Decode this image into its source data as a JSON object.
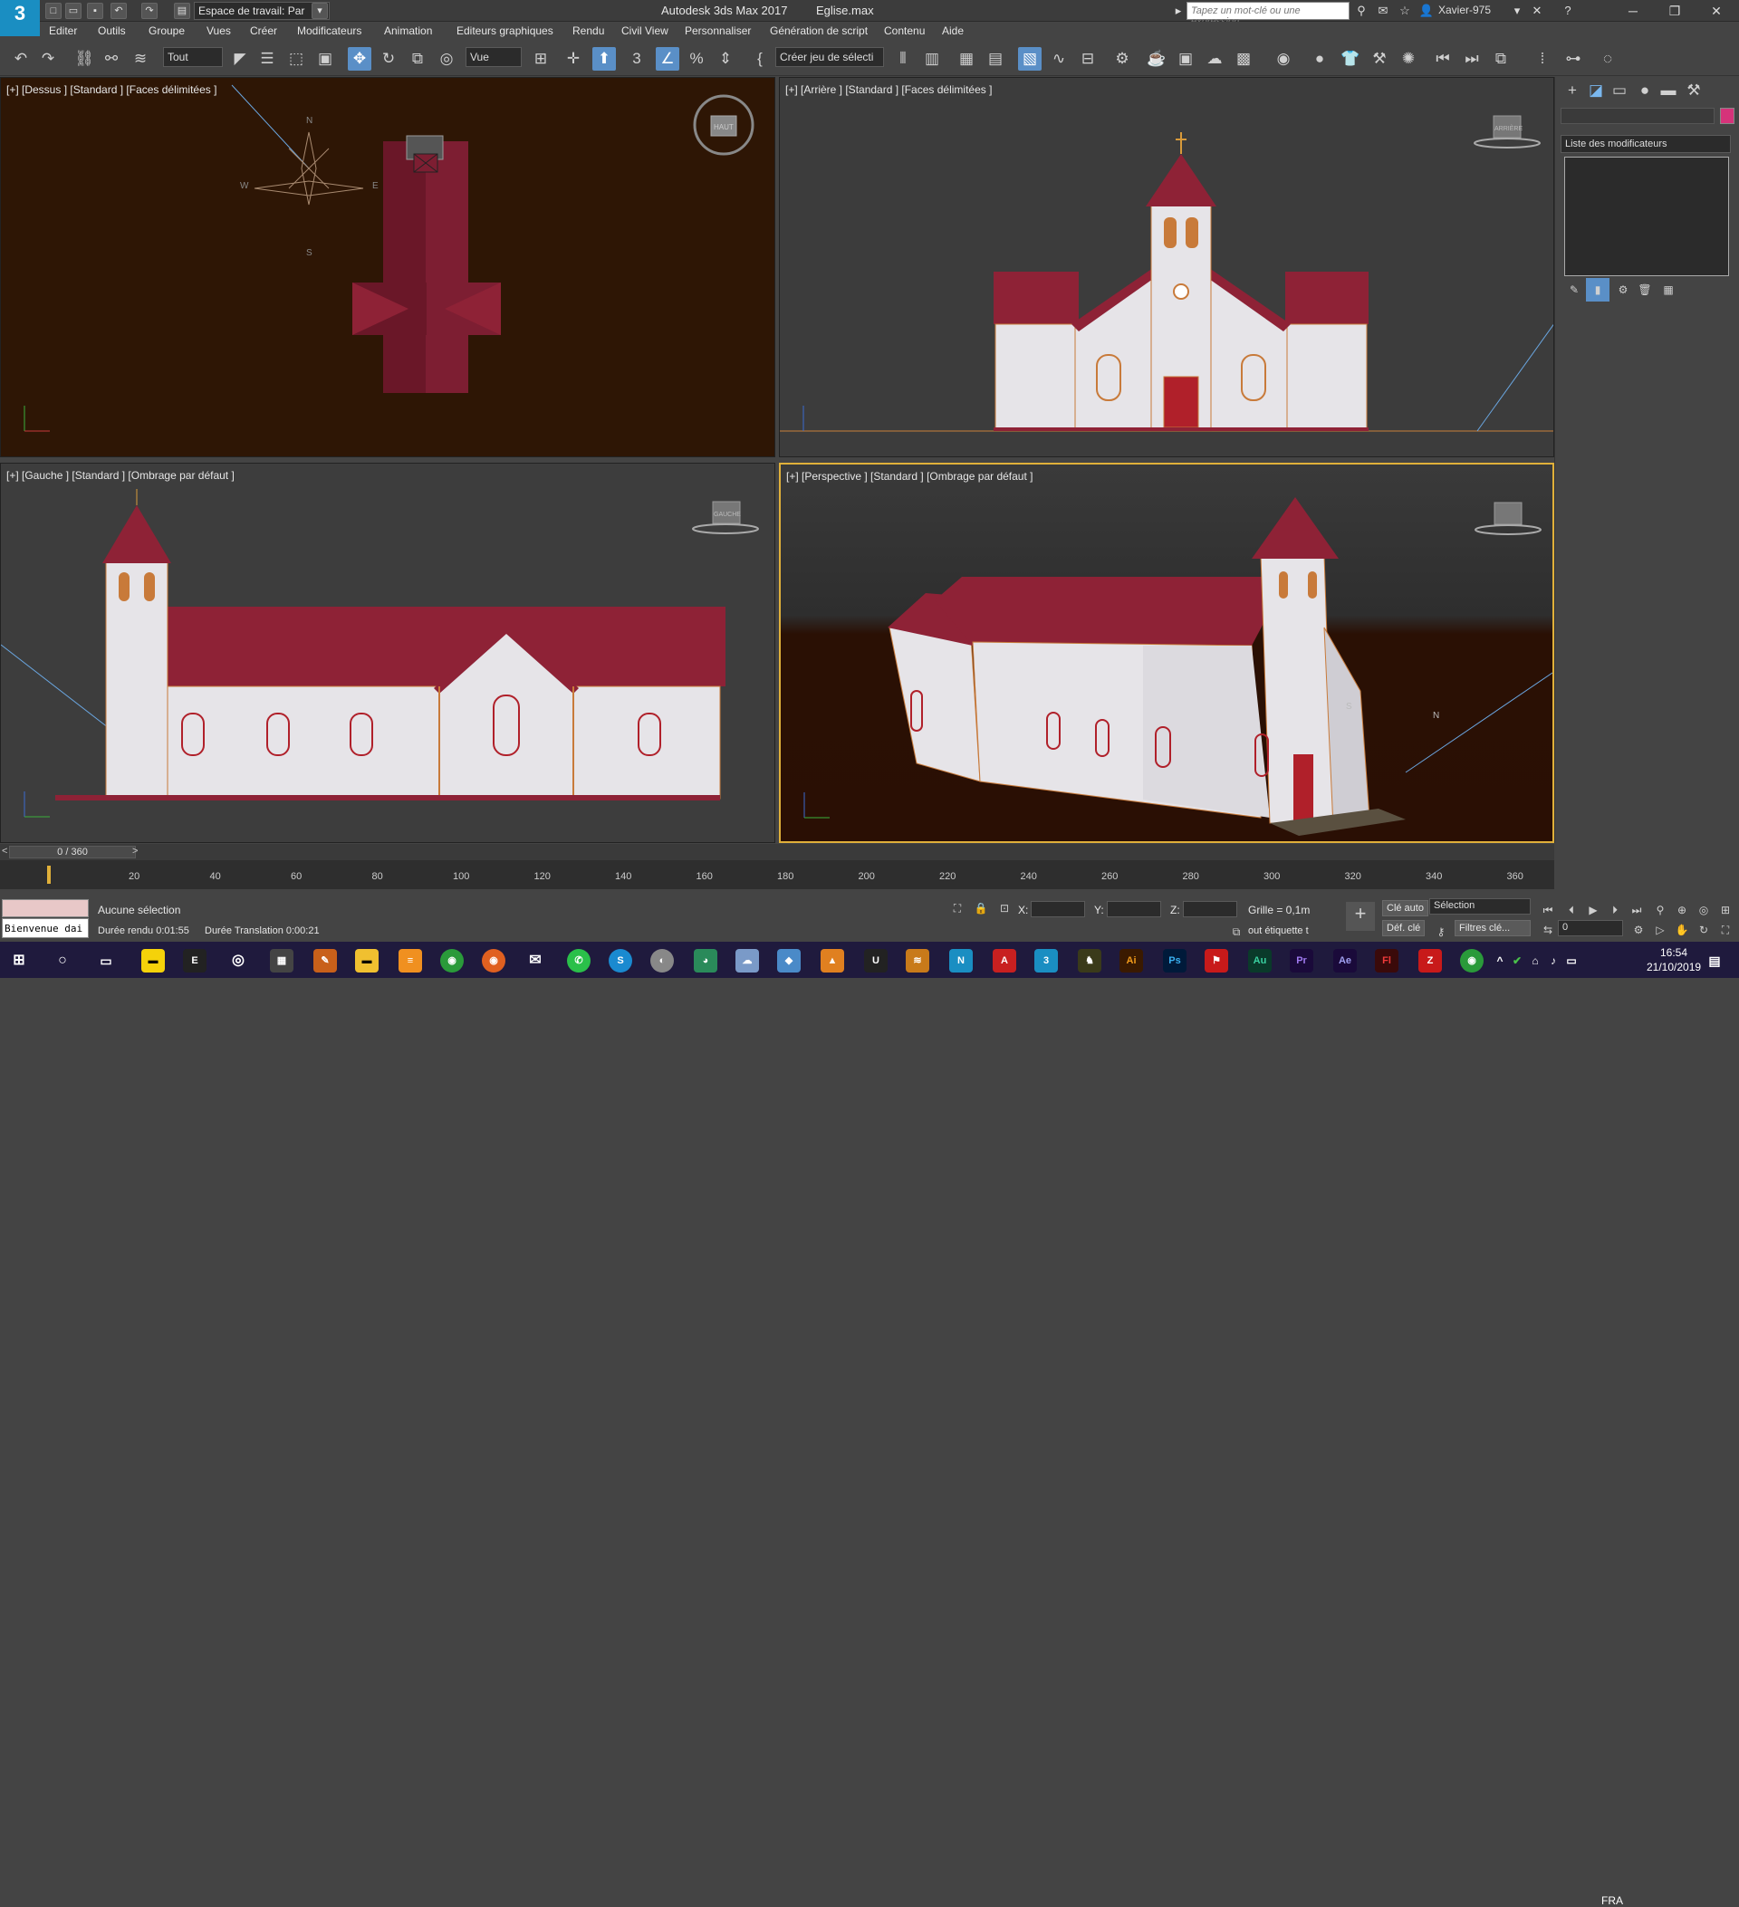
{
  "titlebar": {
    "logo": "3",
    "workspace": "Espace de travail: Par",
    "app_title": "Autodesk 3ds Max 2017",
    "file_title": "Eglise.max",
    "search_placeholder": "Tapez un mot-clé ou une expression",
    "user": "Xavier-975"
  },
  "menu": [
    "Editer",
    "Outils",
    "Groupe",
    "Vues",
    "Créer",
    "Modificateurs",
    "Animation",
    "Editeurs graphiques",
    "Rendu",
    "Civil View",
    "Personnaliser",
    "Génération de script",
    "Contenu",
    "Aide"
  ],
  "toolbar": {
    "filter": "Tout",
    "refcoord": "Vue",
    "selection_set": "Créer jeu de sélecti"
  },
  "viewports": {
    "top": "[+] [Dessus ] [Standard ] [Faces délimitées ]",
    "back": "[+] [Arrière ] [Standard ] [Faces délimitées ]",
    "left": "[+] [Gauche ] [Standard ] [Ombrage par défaut ]",
    "persp": "[+] [Perspective ] [Standard ] [Ombrage par défaut ]",
    "compass": {
      "n": "N",
      "s": "S",
      "e": "E",
      "w": "W"
    },
    "cube_top": "HAUT",
    "cube_back": "ARRIÈRE",
    "cube_left": "GAUCHE"
  },
  "command_panel": {
    "modifier_list": "Liste des modificateurs",
    "color_swatch": "#d6337a"
  },
  "timeline": {
    "slider_label": "0 / 360",
    "ticks": [
      "20",
      "40",
      "60",
      "80",
      "100",
      "120",
      "140",
      "160",
      "180",
      "200",
      "220",
      "240",
      "260",
      "280",
      "300",
      "320",
      "340",
      "360"
    ]
  },
  "status": {
    "welcome": "Bienvenue dai",
    "selection": "Aucune sélection",
    "render_time": "Durée rendu  0:01:55",
    "translation_time": "Durée Translation  0:00:21",
    "x_label": "X:",
    "y_label": "Y:",
    "z_label": "Z:",
    "grid": "Grille = 0,1m",
    "add_tag": "out étiquette t",
    "auto_key": "Clé auto",
    "set_key": "Déf. clé",
    "key_mode": "Sélection",
    "key_filters": "Filtres clé...",
    "frame": "0"
  },
  "taskbar": {
    "lang": "FRA",
    "time": "16:54",
    "date": "21/10/2019"
  },
  "colors": {
    "roof": "#8e2236",
    "wall": "#e6e4e8",
    "trim": "#c87a3a",
    "accent": "#5a8fc7"
  }
}
